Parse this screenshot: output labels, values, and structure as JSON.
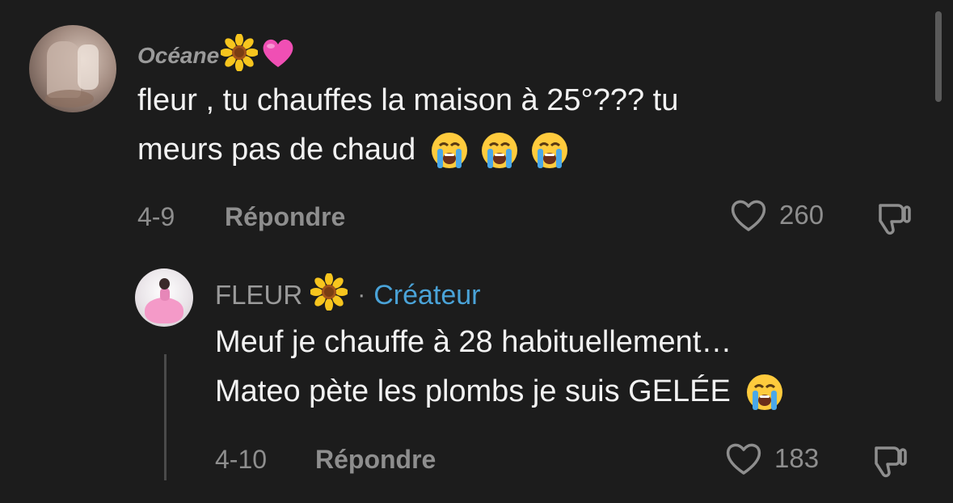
{
  "comments": [
    {
      "author": "Océane",
      "author_emojis": [
        "sunflower-emoji",
        "pink-heart-emoji"
      ],
      "text_lines": [
        "fleur , tu chauffes la maison à 25°??? tu",
        "meurs pas de chaud"
      ],
      "date": "4-9",
      "reply_label": "Répondre",
      "likes": "260"
    },
    {
      "author": "FLEUR",
      "author_badge": "Créateur",
      "separator": "·",
      "text_lines": [
        "Meuf je chauffe à 28 habituellement…",
        "Mateo pète les plombs je suis GELÉE"
      ],
      "date": "4-10",
      "reply_label": "Répondre",
      "likes": "183"
    }
  ],
  "colors": {
    "background": "#1c1c1c",
    "text": "#f2f2f2",
    "muted": "#8e8e8e",
    "creator_badge": "#4aa3d8"
  },
  "icons": [
    "heart-outline-icon",
    "thumbs-down-icon",
    "crying-face-emoji",
    "sunflower-emoji",
    "pink-heart-emoji"
  ]
}
